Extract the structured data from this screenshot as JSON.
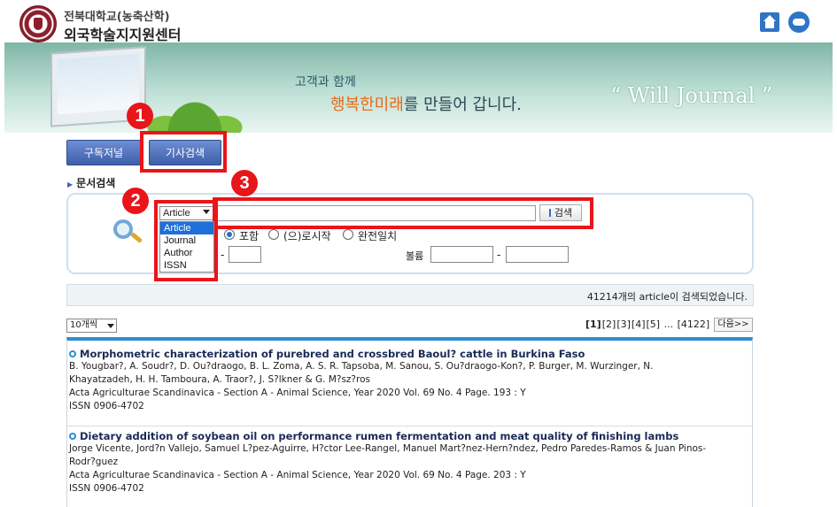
{
  "header": {
    "university": "전북대학교(농축산학)",
    "center": "외국학술지지원센터"
  },
  "banner": {
    "line1": "고객과 함께",
    "line2_highlight": "행복한미래",
    "line2_rest": "를 만들어 갑니다.",
    "quote": "“ Will Journal ”"
  },
  "tabs": [
    {
      "label": "구독저널"
    },
    {
      "label": "기사검색"
    }
  ],
  "annotations": {
    "badge1": "1",
    "badge2": "2",
    "badge3": "3",
    "color": "#e8151a"
  },
  "section_title": "문서검색",
  "search": {
    "field_selected": "Article",
    "field_options": [
      "Article",
      "Journal",
      "Author",
      "ISSN"
    ],
    "query_value": "",
    "button_label": "검색",
    "match_options": [
      {
        "label": "포함",
        "selected": true
      },
      {
        "label": "(으)로시작",
        "selected": false
      },
      {
        "label": "완전일치",
        "selected": false
      }
    ],
    "volume_label": "볼륨"
  },
  "result_summary": "41214개의 article이 검색되었습니다.",
  "list": {
    "per_page": "10개씩",
    "pages": [
      "[1]",
      "[2]",
      "[3]",
      "[4]",
      "[5]",
      "...",
      "[4122]"
    ],
    "current_page": "[1]",
    "next_label": "다음>>"
  },
  "records": [
    {
      "title": "Morphometric characterization of purebred and crossbred Baoul? cattle in Burkina Faso",
      "authors_1": "B. Yougbar?, A. Soudr?, D. Ou?draogo, B. L. Zoma, A. S. R. Tapsoba, M. Sanou, S. Ou?draogo-Kon?, P. Burger, M. Wurzinger, N.",
      "authors_2": "Khayatzadeh, H. H. Tamboura, A. Traor?, J. S?lkner & G. M?sz?ros",
      "source": "Acta Agriculturae Scandinavica - Section A - Animal Science, Year 2020 Vol. 69 No. 4 Page. 193 : Y",
      "issn": "ISSN 0906-4702"
    },
    {
      "title": "Dietary addition of soybean oil on performance rumen fermentation and meat quality of finishing lambs",
      "authors_1": "Jorge Vicente, Jord?n Vallejo, Samuel L?pez-Aguirre, H?ctor Lee-Rangel, Manuel Mart?nez-Hern?ndez, Pedro Paredes-Ramos & Juan Pinos-",
      "authors_2": "Rodr?guez",
      "source": "Acta Agriculturae Scandinavica - Section A - Animal Science, Year 2020 Vol. 69 No. 4 Page. 203 : Y",
      "issn": "ISSN 0906-4702"
    }
  ],
  "icons": {
    "home": "home-icon",
    "chat": "chat-icon",
    "search": "magnifier-icon"
  }
}
